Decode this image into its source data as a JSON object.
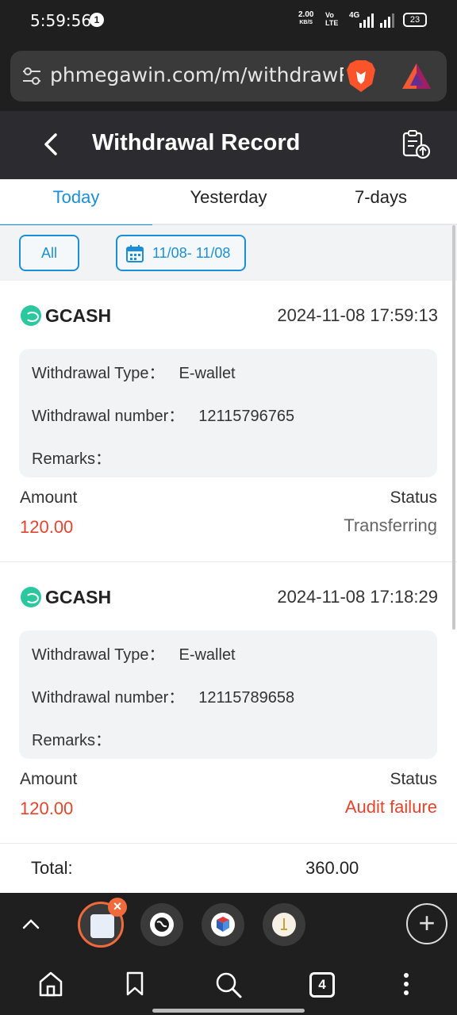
{
  "statusbar": {
    "time": "5:59:56",
    "notification_count": "1",
    "speed_value": "2.00",
    "speed_unit": "KB/S",
    "volte": "Vo LTE",
    "network": "4G",
    "battery": "23"
  },
  "browser": {
    "url": "phmegawin.com/m/withdrawRecord"
  },
  "header": {
    "title": "Withdrawal Record"
  },
  "tabs": [
    {
      "label": "Today",
      "active": true
    },
    {
      "label": "Yesterday",
      "active": false
    },
    {
      "label": "7-days",
      "active": false
    }
  ],
  "filter": {
    "all_label": "All",
    "date_range": "11/08- 11/08"
  },
  "records": [
    {
      "method": "GCASH",
      "datetime": "2024-11-08 17:59:13",
      "type_label": "Withdrawal Type：",
      "type_value": "E-wallet",
      "number_label": "Withdrawal number：",
      "number_value": "12115796765",
      "remarks_label": "Remarks：",
      "remarks_value": "",
      "amount_label": "Amount",
      "amount_value": "120.00",
      "status_label": "Status",
      "status_value": "Transferring"
    },
    {
      "method": "GCASH",
      "datetime": "2024-11-08 17:18:29",
      "type_label": "Withdrawal Type：",
      "type_value": "E-wallet",
      "number_label": "Withdrawal number：",
      "number_value": "12115789658",
      "remarks_label": "Remarks：",
      "remarks_value": "",
      "amount_label": "Amount",
      "amount_value": "120.00",
      "status_label": "Status",
      "status_value": "Audit failure"
    }
  ],
  "total": {
    "label": "Total:",
    "value": "360.00"
  },
  "tabstrip": {
    "open_tabs": "4"
  },
  "colors": {
    "accent": "#1a8fd8",
    "amount_red": "#e5442d",
    "header_bg": "#2b2b30",
    "gcash": "#2bc8a0"
  }
}
